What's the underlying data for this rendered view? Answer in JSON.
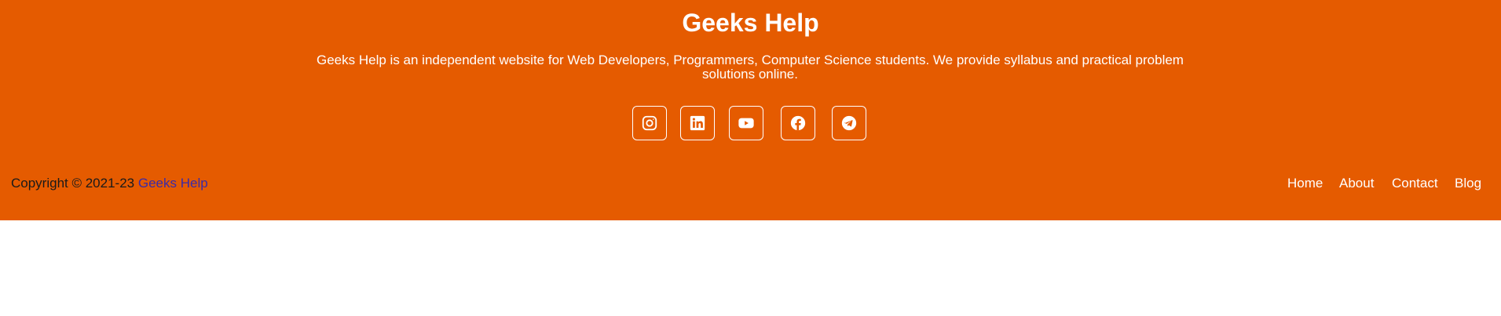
{
  "footer": {
    "title": "Geeks Help",
    "description": "Geeks Help is an independent website for Web Developers, Programmers, Computer Science students. We provide syllabus and practical problem solutions online.",
    "social": [
      {
        "icon": "instagram-icon"
      },
      {
        "icon": "linkedin-icon"
      },
      {
        "icon": "youtube-icon"
      },
      {
        "icon": "facebook-icon"
      },
      {
        "icon": "telegram-icon"
      }
    ],
    "copyright_prefix": "Copyright © 2021-23",
    "copyright_link": "Geeks Help",
    "nav": [
      "Home",
      "About",
      "Contact",
      "Blog"
    ]
  },
  "colors": {
    "background": "#e55b00",
    "text": "#ffffff",
    "link": "#3b2aa8"
  }
}
